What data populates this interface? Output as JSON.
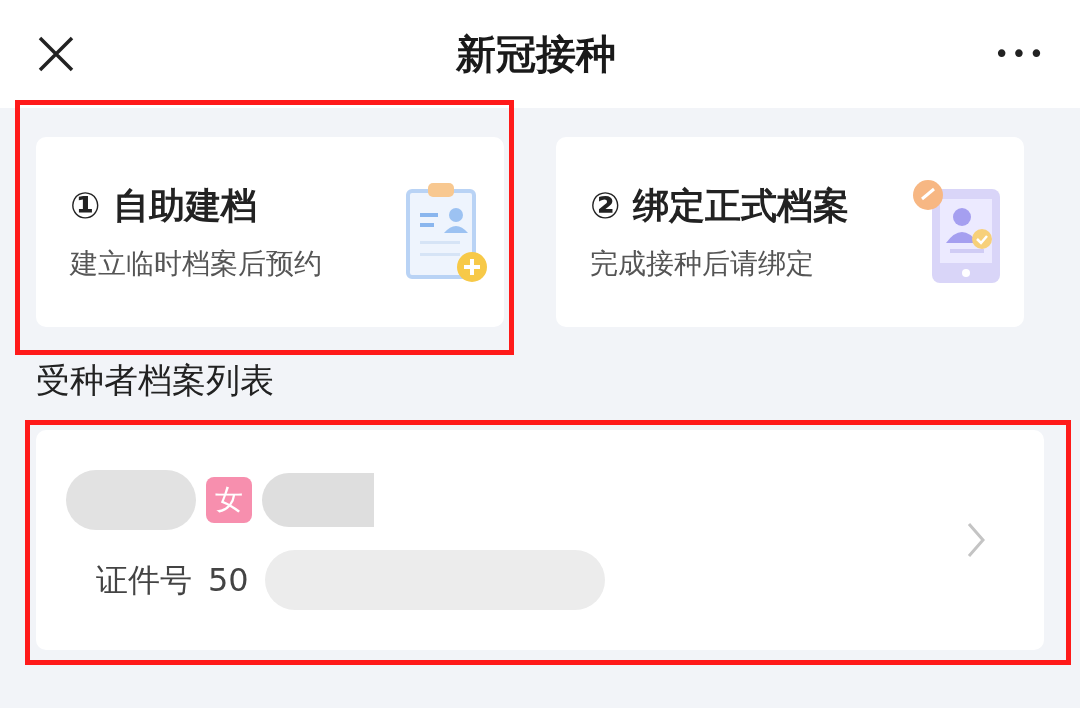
{
  "header": {
    "title": "新冠接种",
    "more": "•••"
  },
  "actions": [
    {
      "number": "①",
      "title": "自助建档",
      "subtitle": "建立临时档案后预约",
      "kind": "clipboard",
      "highlighted": true
    },
    {
      "number": "②",
      "title": "绑定正式档案",
      "subtitle": "完成接种后请绑定",
      "kind": "tablet"
    }
  ],
  "section_title": "受种者档案列表",
  "records": [
    {
      "gender": "女",
      "id_label": "证件号",
      "id_value": "50",
      "highlighted": true
    }
  ]
}
